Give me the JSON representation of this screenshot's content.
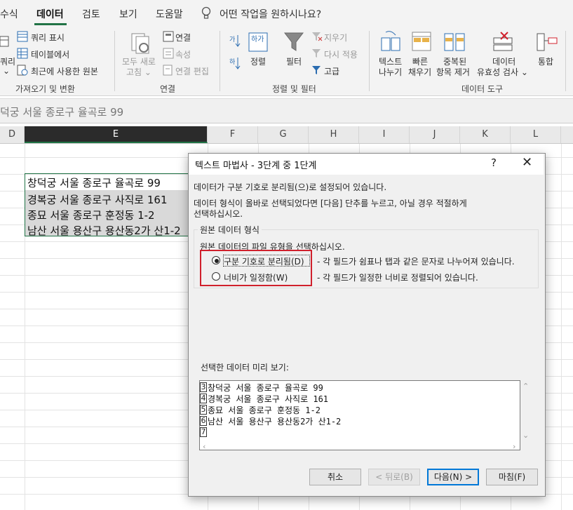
{
  "ribbon_tabs": {
    "formulas": "수식",
    "data": "데이터",
    "review": "검토",
    "view": "보기",
    "help": "도움말",
    "tell_me": "어떤 작업을 원하시나요?"
  },
  "ribbon": {
    "get_transform": {
      "partial_button": "쿼리",
      "show_queries": "쿼리 표시",
      "from_table": "테이블에서",
      "recent_sources": "최근에 사용한 원본",
      "label": "가져오기 및 변환"
    },
    "connections": {
      "refresh_all_1": "모두 새로",
      "refresh_all_2": "고침 ⌄",
      "connections": "연결",
      "properties": "속성",
      "edit_links": "연결 편집",
      "label": "연결"
    },
    "sort_filter": {
      "sort": "정렬",
      "filter": "필터",
      "clear": "지우기",
      "reapply": "다시 적용",
      "advanced": "고급",
      "label": "정렬 및 필터"
    },
    "data_tools": {
      "text_to_columns_1": "텍스트",
      "text_to_columns_2": "나누기",
      "flash_fill_1": "빠른",
      "flash_fill_2": "채우기",
      "remove_duplicates_1": "중복된",
      "remove_duplicates_2": "항목 제거",
      "data_validation_1": "데이터",
      "data_validation_2": "유효성 검사 ⌄",
      "consolidate": "통합",
      "label": "데이터 도구"
    }
  },
  "formula_bar": {
    "content": "덕궁 서울 종로구 율곡로 99"
  },
  "columns": [
    "D",
    "E",
    "F",
    "G",
    "H",
    "I",
    "J",
    "K",
    "L"
  ],
  "cells": [
    "창덕궁 서울 종로구 율곡로 99",
    "경복궁 서울 종로구 사직로 161",
    "종묘 서울 종로구 훈정동 1-2",
    "남산 서울 용산구 용산동2가 산1-2"
  ],
  "dialog": {
    "title": "텍스트 마법사 - 3단계 중 1단계",
    "help": "?",
    "close": "✕",
    "line1": "데이터가 구분 기호로 분리됨(으)로 설정되어 있습니다.",
    "line2": "데이터 형식이 올바로 선택되었다면 [다음] 단추를 누르고, 아닐 경우 적절하게",
    "line3": "선택하십시오.",
    "section_title": "원본 데이터 형식",
    "section_prompt": "원본 데이터의 파일 유형을 선택하십시오.",
    "radio_delimited": "구분 기호로 분리됨(D)",
    "radio_delimited_desc": "- 각 필드가 쉼표나 탭과 같은 문자로 나누어져 있습니다.",
    "radio_fixed": "너비가 일정함(W)",
    "radio_fixed_desc": "- 각 필드가 일정한 너비로 정렬되어 있습니다.",
    "preview_label": "선택한 데이터 미리 보기:",
    "preview_rows": [
      {
        "num": "3",
        "text": "창덕궁 서울 종로구 율곡로 99"
      },
      {
        "num": "4",
        "text": "경복궁 서울 종로구 사직로 161"
      },
      {
        "num": "5",
        "text": "종묘 서울 종로구 훈정동 1-2"
      },
      {
        "num": "6",
        "text": "남산 서울 용산구 용산동2가 산1-2"
      },
      {
        "num": "7",
        "text": ""
      }
    ],
    "buttons": {
      "cancel": "취소",
      "back": "< 뒤로(B)",
      "next": "다음(N) >",
      "finish": "마침(F)"
    }
  },
  "colors": {
    "excel_green": "#217346",
    "highlight_red": "#d0202c",
    "focus_blue": "#0078d7"
  }
}
